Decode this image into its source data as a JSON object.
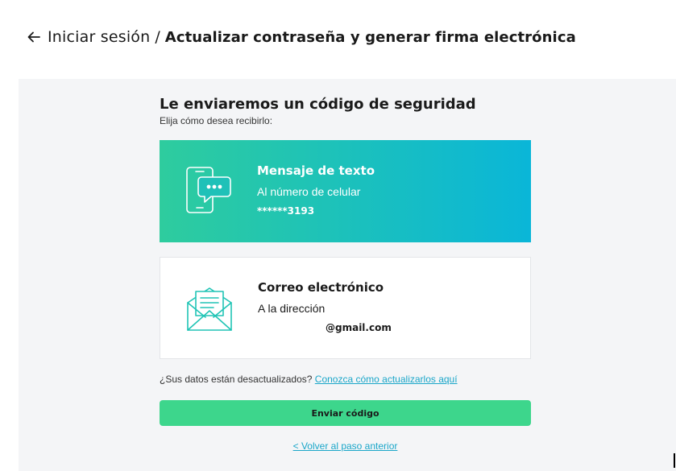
{
  "header": {
    "breadcrumb_link": "Iniciar sesión",
    "separator": "/",
    "current_page": "Actualizar contraseña y generar firma electrónica"
  },
  "main": {
    "title": "Le enviaremos un código de seguridad",
    "subtitle": "Elija cómo desea recibirlo:",
    "options": [
      {
        "title": "Mensaje de texto",
        "description": "Al número de celular",
        "value": "******3193",
        "icon": "smartphone-message-icon",
        "selected": true
      },
      {
        "title": "Correo electrónico",
        "description": "A la dirección",
        "value": "@gmail.com",
        "icon": "email-envelope-icon",
        "selected": false
      }
    ],
    "outdated_text": "¿Sus datos están desactualizados?",
    "outdated_link": "Conozca cómo actualizarlos aquí",
    "send_button": "Enviar código",
    "back_link": "<  Volver al paso anterior"
  },
  "colors": {
    "gradient_start": "#2ecc9e",
    "gradient_end": "#0ab6d8",
    "button": "#3dd68c",
    "link": "#1aa6c9",
    "panel_bg": "#f4f5f7"
  }
}
